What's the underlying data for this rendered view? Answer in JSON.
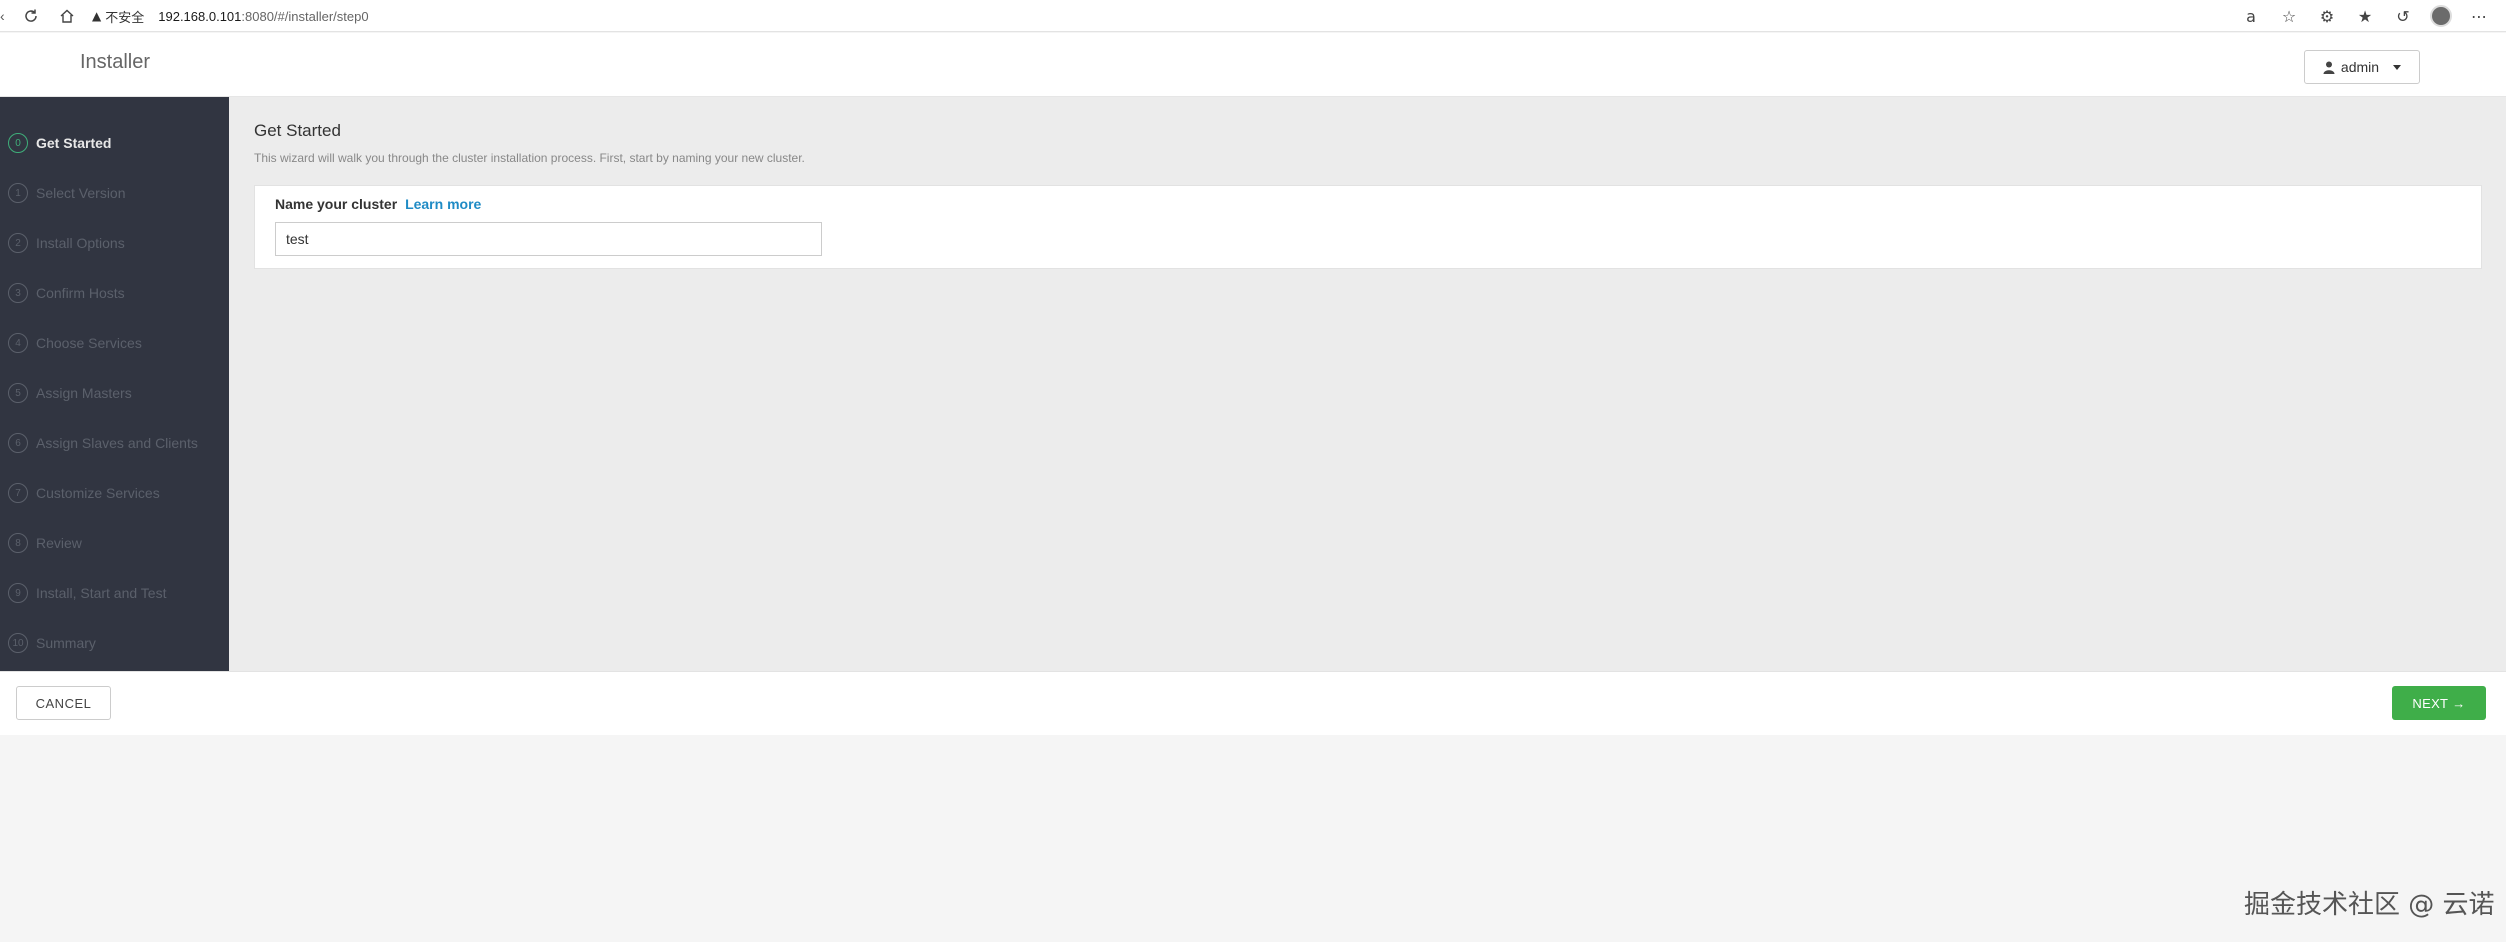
{
  "browser": {
    "security_label": "不安全",
    "url_host": "192.168.0.101",
    "url_rest": ":8080/#/installer/step0"
  },
  "header": {
    "title": "Installer",
    "user_label": "admin"
  },
  "sidebar": {
    "steps": [
      {
        "num": "0",
        "label": "Get Started"
      },
      {
        "num": "1",
        "label": "Select Version"
      },
      {
        "num": "2",
        "label": "Install Options"
      },
      {
        "num": "3",
        "label": "Confirm Hosts"
      },
      {
        "num": "4",
        "label": "Choose Services"
      },
      {
        "num": "5",
        "label": "Assign Masters"
      },
      {
        "num": "6",
        "label": "Assign Slaves and Clients"
      },
      {
        "num": "7",
        "label": "Customize Services"
      },
      {
        "num": "8",
        "label": "Review"
      },
      {
        "num": "9",
        "label": "Install, Start and Test"
      },
      {
        "num": "10",
        "label": "Summary"
      }
    ],
    "active_step": 0
  },
  "main": {
    "title": "Get Started",
    "description": "This wizard will walk you through the cluster installation process. First, start by naming your new cluster.",
    "field_label": "Name your cluster",
    "learn_more": "Learn more",
    "cluster_name_value": "test"
  },
  "footer": {
    "cancel_label": "CANCEL",
    "next_label": "NEXT",
    "next_arrow": "→"
  },
  "watermark": "掘金技术社区 @ 云诺",
  "colors": {
    "sidebar_bg": "#313541",
    "active_step": "#3fae7a",
    "next_button": "#3fae49",
    "link": "#1f8bc5"
  }
}
